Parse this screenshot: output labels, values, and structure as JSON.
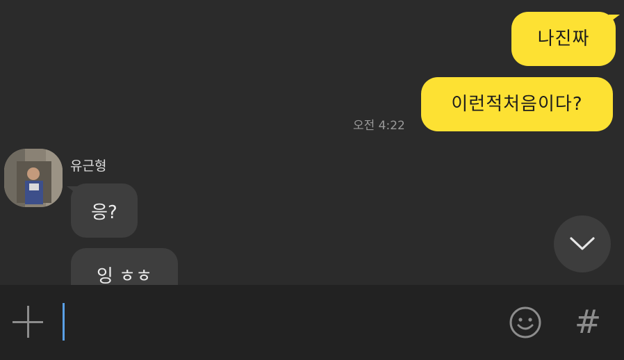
{
  "messages_out": [
    {
      "text": "나진짜"
    },
    {
      "text": "이런적처음이다?",
      "time": "오전 4:22"
    }
  ],
  "sender": {
    "name": "유근형"
  },
  "messages_in": [
    {
      "text": "응?"
    },
    {
      "text": "잉 ㅎㅎ"
    }
  ],
  "icons": {
    "scroll": "chevron-down-icon",
    "attach": "plus-icon",
    "emoji": "smiley-icon",
    "hashtag": "hash-icon",
    "hashtag_glyph": "#"
  },
  "colors": {
    "outgoing_bubble": "#fde133",
    "incoming_bubble": "#3e3e3e",
    "background": "#2b2b2b",
    "input_bar": "#222222",
    "caret": "#5aa0e6"
  }
}
